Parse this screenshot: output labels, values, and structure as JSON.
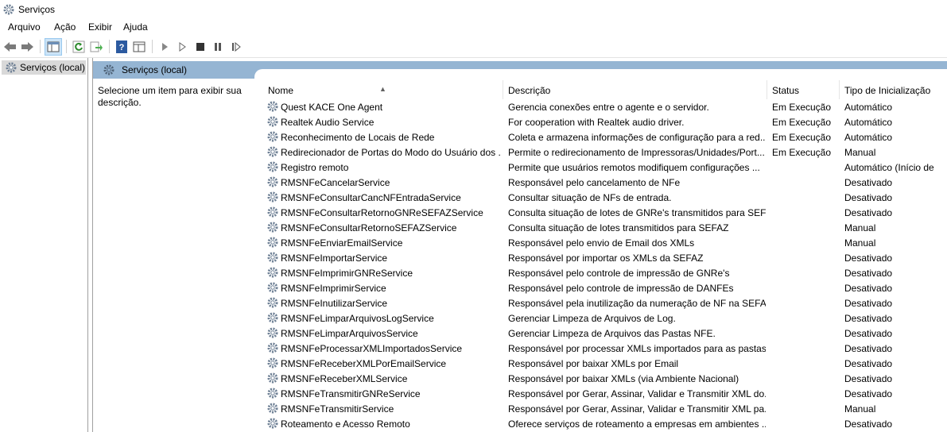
{
  "window": {
    "title": "Serviços"
  },
  "menu": [
    "Arquivo",
    "Ação",
    "Exibir",
    "Ajuda"
  ],
  "tree": {
    "item": "Serviços (local)"
  },
  "banner": {
    "title": "Serviços (local)"
  },
  "description_pane": {
    "text": "Selecione um item para exibir sua descrição."
  },
  "table": {
    "columns": [
      "Nome",
      "Descrição",
      "Status",
      "Tipo de Inicialização"
    ],
    "rows": [
      {
        "name": "Quest KACE One Agent",
        "desc": "Gerencia conexões entre o agente e o servidor.",
        "status": "Em Execução",
        "type": "Automático"
      },
      {
        "name": "Realtek Audio Service",
        "desc": "For cooperation with Realtek audio driver.",
        "status": "Em Execução",
        "type": "Automático"
      },
      {
        "name": "Reconhecimento de Locais de Rede",
        "desc": "Coleta e armazena informações de configuração para a red...",
        "status": "Em Execução",
        "type": "Automático"
      },
      {
        "name": "Redirecionador de Portas do Modo do Usuário dos ...",
        "desc": "Permite o redirecionamento de Impressoras/Unidades/Port...",
        "status": "Em Execução",
        "type": "Manual"
      },
      {
        "name": "Registro remoto",
        "desc": "Permite que usuários remotos modifiquem configurações ...",
        "status": "",
        "type": "Automático (Início de"
      },
      {
        "name": "RMSNFeCancelarService",
        "desc": "Responsável pelo cancelamento de NFe",
        "status": "",
        "type": "Desativado"
      },
      {
        "name": "RMSNFeConsultarCancNFEntradaService",
        "desc": "Consultar situação de NFs de entrada.",
        "status": "",
        "type": "Desativado"
      },
      {
        "name": "RMSNFeConsultarRetornoGNReSEFAZService",
        "desc": "Consulta situação de lotes de GNRe's transmitidos para SEF...",
        "status": "",
        "type": "Desativado"
      },
      {
        "name": "RMSNFeConsultarRetornoSEFAZService",
        "desc": "Consulta situação de lotes transmitidos para SEFAZ",
        "status": "",
        "type": "Manual"
      },
      {
        "name": "RMSNFeEnviarEmailService",
        "desc": "Responsável pelo envio de Email dos XMLs",
        "status": "",
        "type": "Manual"
      },
      {
        "name": "RMSNFeImportarService",
        "desc": "Responsável por importar os XMLs da SEFAZ",
        "status": "",
        "type": "Desativado"
      },
      {
        "name": "RMSNFeImprimirGNReService",
        "desc": "Responsável pelo controle de impressão de GNRe's",
        "status": "",
        "type": "Desativado"
      },
      {
        "name": "RMSNFeImprimirService",
        "desc": "Responsável pelo controle de impressão de DANFEs",
        "status": "",
        "type": "Desativado"
      },
      {
        "name": "RMSNFeInutilizarService",
        "desc": "Responsável pela inutilização da numeração de NF na SEFAZ",
        "status": "",
        "type": "Desativado"
      },
      {
        "name": "RMSNFeLimparArquivosLogService",
        "desc": "Gerenciar Limpeza de Arquivos de Log.",
        "status": "",
        "type": "Desativado"
      },
      {
        "name": "RMSNFeLimparArquivosService",
        "desc": "Gerenciar Limpeza de Arquivos das Pastas NFE.",
        "status": "",
        "type": "Desativado"
      },
      {
        "name": "RMSNFeProcessarXMLImportadosService",
        "desc": "Responsável por processar XMLs importados para as pastas...",
        "status": "",
        "type": "Desativado"
      },
      {
        "name": "RMSNFeReceberXMLPorEmailService",
        "desc": "Responsável por baixar XMLs por Email",
        "status": "",
        "type": "Desativado"
      },
      {
        "name": "RMSNFeReceberXMLService",
        "desc": "Responsável por baixar XMLs (via Ambiente Nacional)",
        "status": "",
        "type": "Desativado"
      },
      {
        "name": "RMSNFeTransmitirGNReService",
        "desc": "Responsável por Gerar, Assinar, Validar e Transmitir XML do...",
        "status": "",
        "type": "Desativado"
      },
      {
        "name": "RMSNFeTransmitirService",
        "desc": "Responsável por Gerar, Assinar, Validar e Transmitir XML pa...",
        "status": "",
        "type": "Manual"
      },
      {
        "name": "Roteamento e Acesso Remoto",
        "desc": "Oferece serviços de roteamento a empresas em ambientes ...",
        "status": "",
        "type": "Desativado"
      }
    ]
  },
  "icons": {
    "gear_color": "#6d7f94",
    "banner_color": "#95b5d3"
  }
}
